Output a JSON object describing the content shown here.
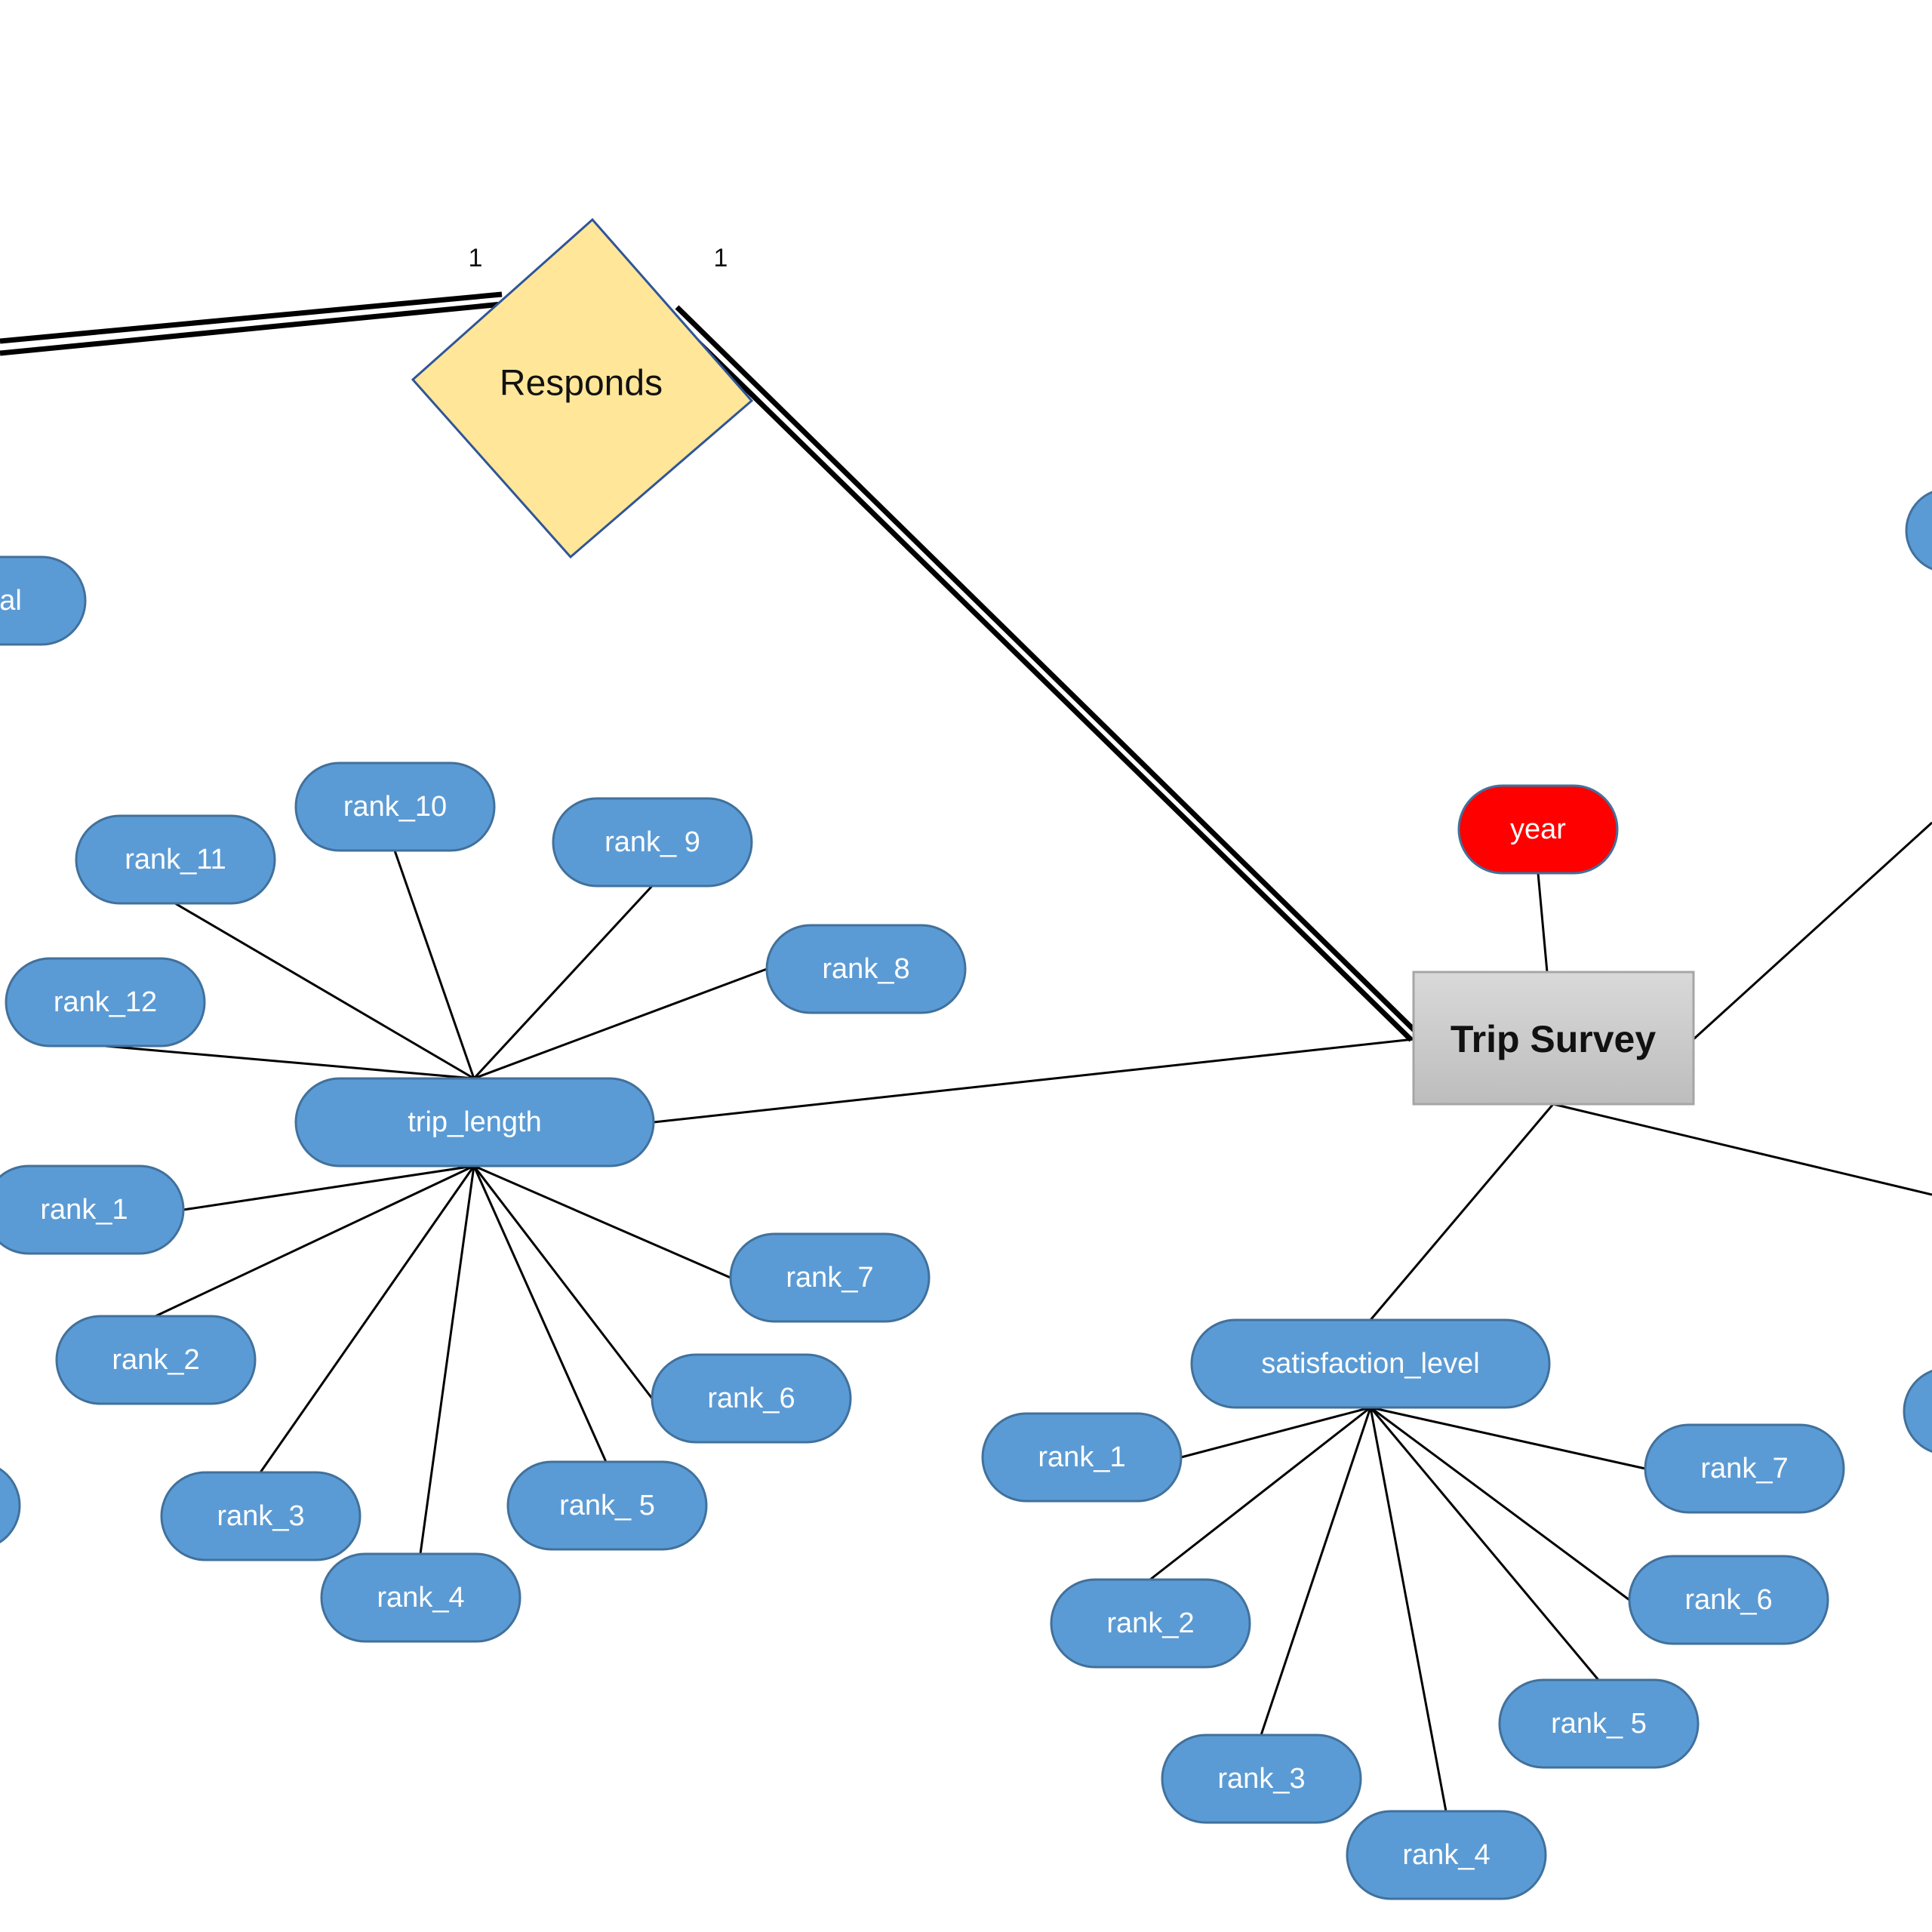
{
  "diagram": {
    "type": "er-diagram",
    "colors": {
      "attribute_fill": "#5b9bd5",
      "attribute_stroke": "#41719c",
      "key_attribute_fill": "#ff0000",
      "relationship_fill": "#ffe699",
      "relationship_stroke": "#2f5597",
      "entity_fill_top": "#d9d9d9",
      "entity_fill_bottom": "#bfbfbf",
      "entity_stroke": "#a6a6a6",
      "line": "#000000"
    },
    "relationship": {
      "label": "Responds",
      "cardinality_left": "1",
      "cardinality_right": "1"
    },
    "entity": {
      "label": "Trip Survey",
      "key_attribute": "year"
    },
    "composite_attributes": [
      {
        "id": "trip_length",
        "label": "trip_length",
        "children": [
          "rank_1",
          "rank_2",
          "rank_3",
          "rank_4",
          "rank_ 5",
          "rank_6",
          "rank_7",
          "rank_8",
          "rank_ 9",
          "rank_10",
          "rank_11",
          "rank_12"
        ]
      },
      {
        "id": "satisfaction_level",
        "label": "satisfaction_level",
        "children": [
          "rank_1",
          "rank_2",
          "rank_3",
          "rank_4",
          "rank_ 5",
          "rank_6",
          "rank_7"
        ]
      }
    ],
    "partial_labels": {
      "left_attribute_fragment": "al"
    }
  }
}
